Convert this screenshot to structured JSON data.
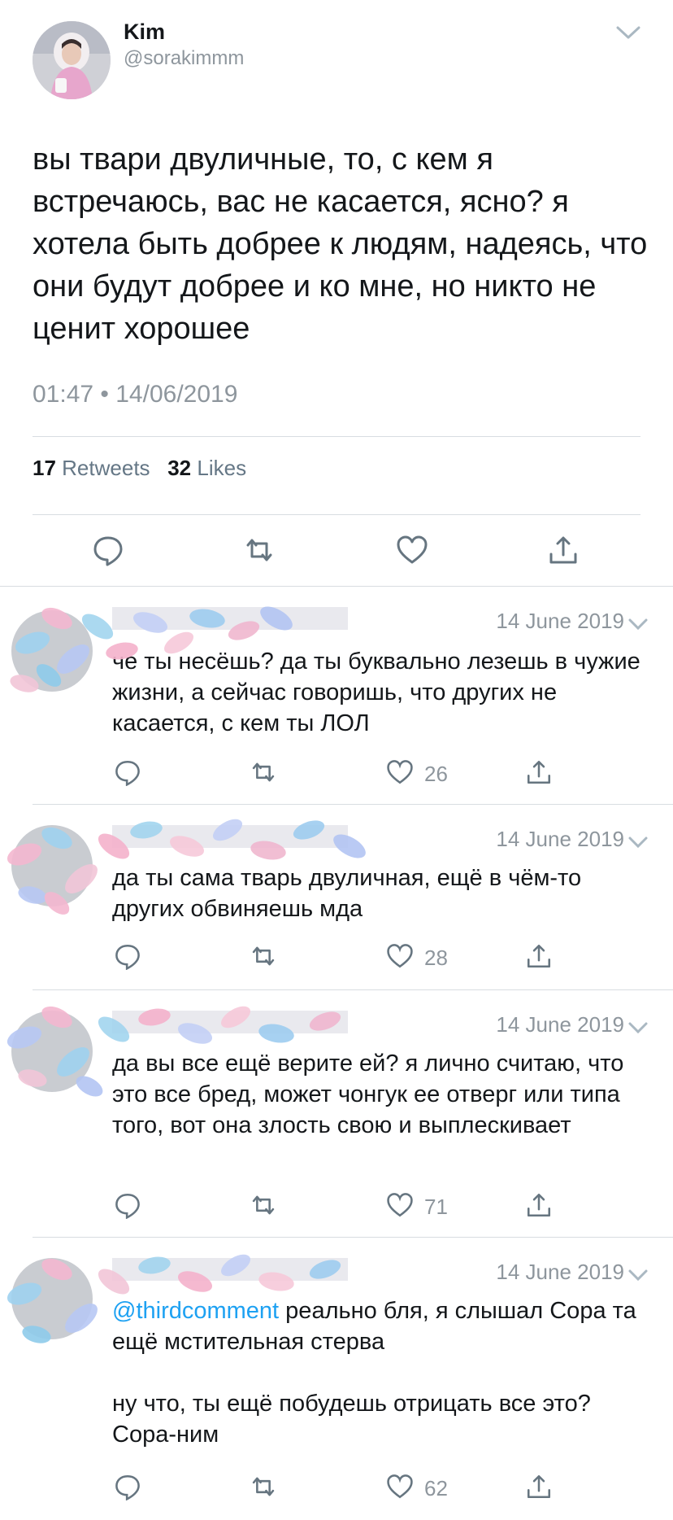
{
  "main_tweet": {
    "name": "Kim",
    "handle": "@sorakimmm",
    "text": "вы твари двуличные, то, с кем я встречаюсь, вас не касается, ясно? я хотела быть добрее к людям, надеясь, что они будут добрее и ко мне, но никто не ценит хорошее",
    "time": "01:47 • 14/06/2019",
    "retweets_count": "17",
    "retweets_label": "Retweets",
    "likes_count": "32",
    "likes_label": "Likes"
  },
  "replies": [
    {
      "date": "14 June 2019",
      "text": "че ты несёшь? да ты буквально лезешь в чужие жизни, а сейчас говоришь, что других не касается, с кем ты ЛОЛ",
      "likes": "26"
    },
    {
      "date": "14 June 2019",
      "text": "да ты сама тварь двуличная, ещё в чём-то других обвиняешь мда",
      "likes": "28"
    },
    {
      "date": "14 June 2019",
      "text": "да вы все ещё верите ей? я лично считаю, что это все бред, может чонгук ее отверг или типа того, вот она злость свою и выплескивает",
      "likes": "71"
    },
    {
      "date": "14 June 2019",
      "mention": "@thirdcomment",
      "text": " реально бля, я слышал Сора та ещё мстительная стерва\n\nну что, ты ещё побудешь отрицать все это? Сора-ним",
      "likes": "62"
    }
  ],
  "icons": [
    "reply-icon",
    "retweet-icon",
    "like-icon",
    "share-icon",
    "chevron-down-icon"
  ],
  "colors": {
    "text": "#14171a",
    "muted": "#8e969d",
    "link": "#1da1f2",
    "divider": "#d8dde1"
  }
}
